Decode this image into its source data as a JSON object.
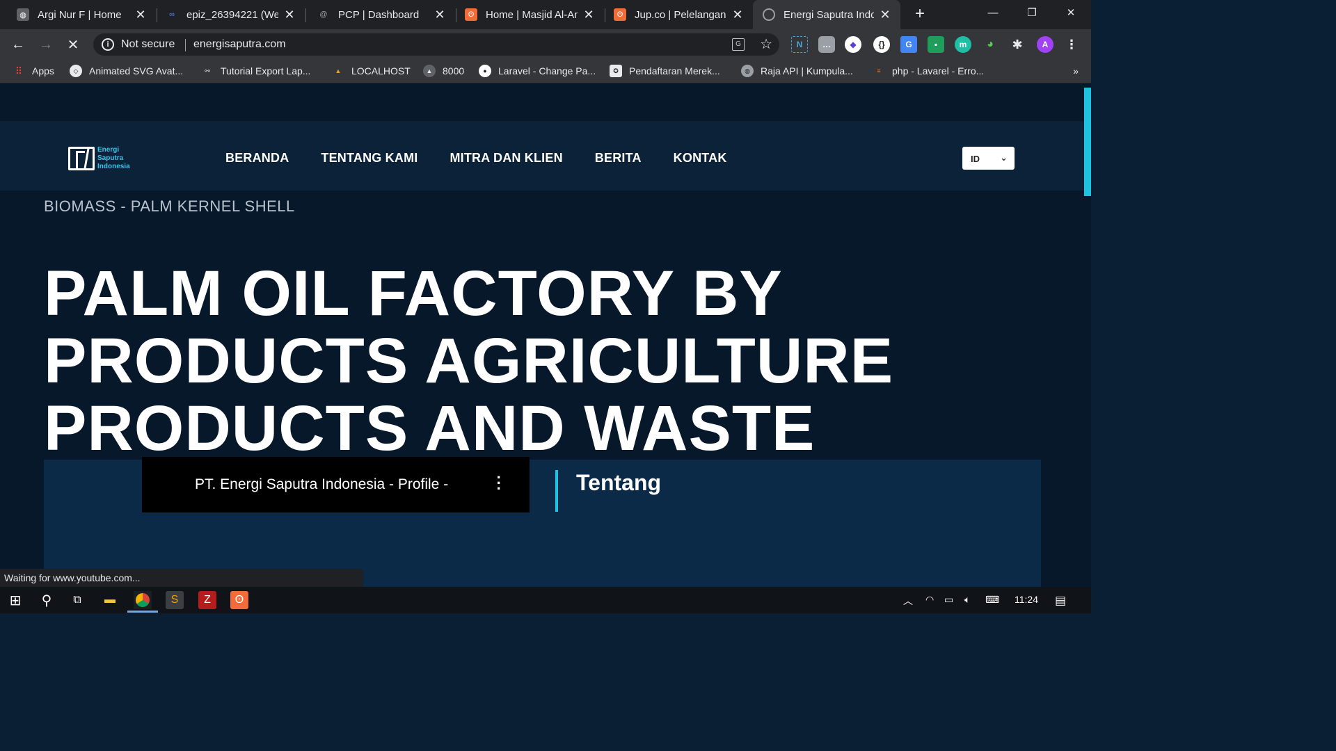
{
  "browser": {
    "tabs": [
      {
        "title": "Argi Nur F | Home",
        "fav_color": "#5f6368"
      },
      {
        "title": "epiz_26394221 (Web",
        "fav_color": "#1a73e8"
      },
      {
        "title": "PCP | Dashboard",
        "fav_color": "#5f6368"
      },
      {
        "title": "Home | Masjid Al-An",
        "fav_color": "#f26b3a"
      },
      {
        "title": "Jup.co | Pelelangan C",
        "fav_color": "#f26b3a"
      },
      {
        "title": "Energi Saputra Indon",
        "fav_color": "#9aa0a6"
      }
    ],
    "security_label": "Not secure",
    "url": "energisaputra.com",
    "profile_initial": "A",
    "bookmarks": [
      {
        "label": "Apps"
      },
      {
        "label": "Animated SVG Avat..."
      },
      {
        "label": "Tutorial Export Lap..."
      },
      {
        "label": "LOCALHOST"
      },
      {
        "label": "8000"
      },
      {
        "label": "Laravel - Change Pa..."
      },
      {
        "label": "Pendaftaran Merek..."
      },
      {
        "label": "Raja API | Kumpula..."
      },
      {
        "label": "php - Lavarel - Erro..."
      }
    ],
    "more_bookmarks": "»",
    "status_text": "Waiting for www.youtube.com..."
  },
  "site": {
    "logo_lines": [
      "Energi",
      "Saputra",
      "Indonesia"
    ],
    "nav": [
      "BERANDA",
      "TENTANG KAMI",
      "MITRA DAN KLIEN",
      "BERITA",
      "KONTAK"
    ],
    "language": "ID",
    "breadcrumb": "BIOMASS - PALM KERNEL SHELL",
    "hero_lines": [
      "PALM OIL FACTORY BY",
      "PRODUCTS AGRICULTURE",
      "PRODUCTS AND WASTE"
    ],
    "video_title": "PT. Energi Saputra Indonesia - Profile -",
    "about_heading": "Tentang"
  },
  "taskbar": {
    "clock": "11:24"
  },
  "colors": {
    "accent": "#1fc2e0",
    "page_bg": "#08182b",
    "header_bg": "#0b2239"
  }
}
